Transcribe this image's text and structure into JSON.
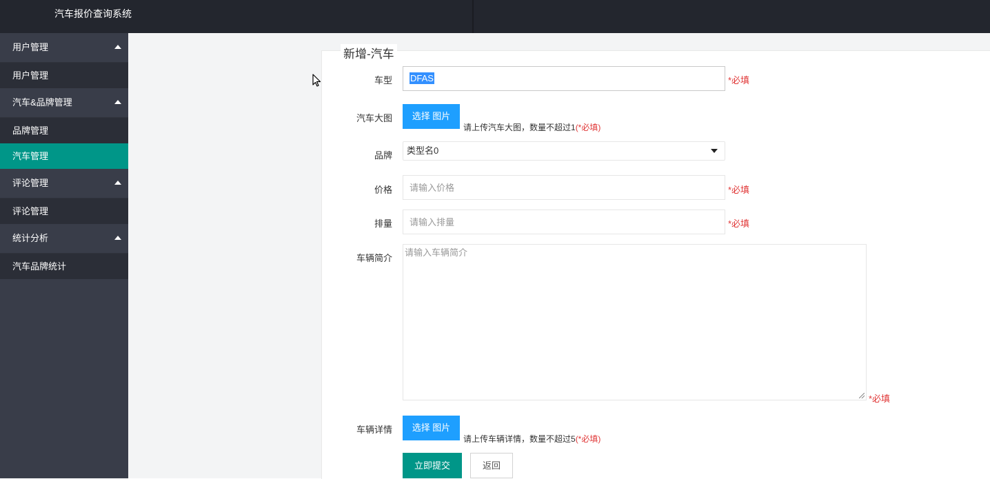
{
  "app": {
    "title": "汽车报价查询系统"
  },
  "sidebar": {
    "groups": [
      {
        "label": "用户管理",
        "items": [
          {
            "label": "用户管理"
          }
        ]
      },
      {
        "label": "汽车&品牌管理",
        "items": [
          {
            "label": "品牌管理"
          },
          {
            "label": "汽车管理"
          }
        ]
      },
      {
        "label": "评论管理",
        "items": [
          {
            "label": "评论管理"
          }
        ]
      },
      {
        "label": "统计分析",
        "items": [
          {
            "label": "汽车品牌统计"
          }
        ]
      }
    ],
    "active_item": "汽车管理"
  },
  "form": {
    "title": "新增-汽车",
    "required_mark": "*必填",
    "model": {
      "label": "车型",
      "value": "DFAS"
    },
    "main_image": {
      "label": "汽车大图",
      "button": "选择 图片",
      "hint": "请上传汽车大图，数量不超过1",
      "hint_req": "(*必填)"
    },
    "brand": {
      "label": "品牌",
      "selected": "类型名0"
    },
    "price": {
      "label": "价格",
      "placeholder": "请输入价格"
    },
    "displacement": {
      "label": "排量",
      "placeholder": "请输入排量"
    },
    "intro": {
      "label": "车辆简介",
      "placeholder": "请输入车辆简介"
    },
    "detail_images": {
      "label": "车辆详情",
      "button": "选择 图片",
      "hint": "请上传车辆详情，数量不超过5",
      "hint_req": "(*必填)"
    },
    "submit_label": "立即提交",
    "back_label": "返回"
  },
  "colors": {
    "topbar": "#23262e",
    "sidebar": "#393d49",
    "active": "#009688",
    "upload": "#1e9fff",
    "required": "#e03636"
  }
}
